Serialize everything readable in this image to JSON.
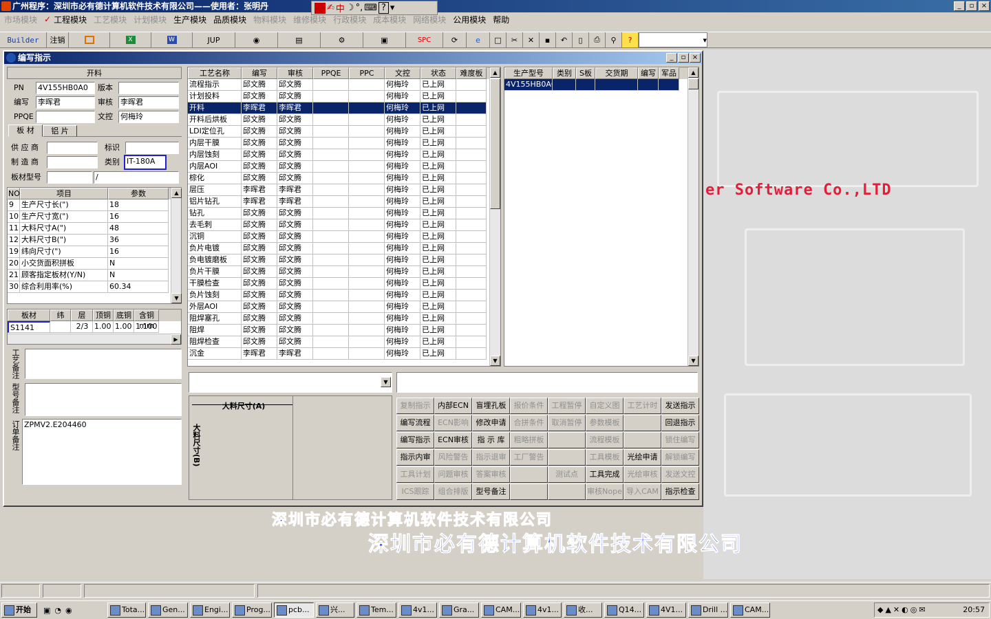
{
  "app": {
    "title": "广州程序：深圳市必有德计算机软件技术有限公司——使用者：张明丹"
  },
  "ime": {
    "zh": "中",
    "window_buttons": [
      "_",
      "▫",
      "×"
    ]
  },
  "menu": [
    {
      "label": "市场模块",
      "enabled": false
    },
    {
      "label": "工程模块",
      "enabled": true
    },
    {
      "label": "工艺模块",
      "enabled": false
    },
    {
      "label": "计划模块",
      "enabled": false
    },
    {
      "label": "生产模块",
      "enabled": true
    },
    {
      "label": "品质模块",
      "enabled": true
    },
    {
      "label": "物料模块",
      "enabled": false
    },
    {
      "label": "维修模块",
      "enabled": false
    },
    {
      "label": "行政模块",
      "enabled": false
    },
    {
      "label": "成本模块",
      "enabled": false
    },
    {
      "label": "网络模块",
      "enabled": false
    },
    {
      "label": "公用模块",
      "enabled": true
    },
    {
      "label": "帮助",
      "enabled": true
    }
  ],
  "toolbar": {
    "builder": "Builder",
    "cancel": "注销",
    "jup": "JUP",
    "spc": "SPC"
  },
  "background": {
    "software": "er Software Co.,LTD",
    "company_small": "深圳市必有德计算机软件技术有限公司",
    "company_large": "深圳市必有德计算机软件技术有限公司"
  },
  "dialog": {
    "title": "编写指示",
    "section": "开料",
    "pn_label": "PN",
    "pn": "4V155HB0A0",
    "version_label": "版本",
    "version": "",
    "writer_label": "编写",
    "writer": "李晖君",
    "reviewer_label": "审核",
    "reviewer": "李晖君",
    "ppqe_label": "PPQE",
    "ppqe": "",
    "doc_label": "文控",
    "doc": "何梅玲",
    "tabs": [
      "板 材",
      "铝 片"
    ],
    "supplier_label": "供 应 商",
    "supplier": "",
    "mark_label": "标识",
    "mark": "",
    "maker_label": "制 造 商",
    "maker": "",
    "type_label": "类别",
    "type": "IT-180A",
    "model_label": "板材型号",
    "model": "",
    "model2": "/",
    "param_headers": [
      "NO",
      "项目",
      "参数"
    ],
    "params": [
      {
        "no": "9",
        "item": "生产尺寸长(\")",
        "val": "18"
      },
      {
        "no": "10",
        "item": "生产尺寸宽(\")",
        "val": "16"
      },
      {
        "no": "11",
        "item": "大料尺寸A(\")",
        "val": "48"
      },
      {
        "no": "12",
        "item": "大料尺寸B(\")",
        "val": "36"
      },
      {
        "no": "19",
        "item": "纬向尺寸(\")",
        "val": "16"
      },
      {
        "no": "20",
        "item": "小交货面积拼板",
        "val": "N"
      },
      {
        "no": "21",
        "item": "顾客指定板材(Y/N)",
        "val": "N"
      },
      {
        "no": "30",
        "item": "综合利用率(%)",
        "val": "60.34"
      }
    ],
    "mat_headers": [
      "板材",
      "纬",
      "层",
      "顶铜",
      "底铜",
      "含铜mm"
    ],
    "mat_row": {
      "name": "S1141",
      "weft": "",
      "layer": "2/3",
      "top": "1.00",
      "bottom": "1.00",
      "cu": "1.100"
    },
    "remark_labels": [
      "工艺备注",
      "型号备注",
      "订单备注"
    ],
    "order_remark": "ZPMV2.E204460",
    "process_headers": [
      "工艺名称",
      "编写",
      "审核",
      "PPQE",
      "PPC",
      "文控",
      "状态",
      "难度板"
    ],
    "processes": [
      {
        "name": "流程指示",
        "w": "邱文腾",
        "r": "邱文腾",
        "d": "何梅玲",
        "s": "已上网"
      },
      {
        "name": "计划投料",
        "w": "邱文腾",
        "r": "邱文腾",
        "d": "何梅玲",
        "s": "已上网"
      },
      {
        "name": "开料",
        "w": "李晖君",
        "r": "李晖君",
        "d": "何梅玲",
        "s": "已上网",
        "sel": true
      },
      {
        "name": "开料后烘板",
        "w": "邱文腾",
        "r": "邱文腾",
        "d": "何梅玲",
        "s": "已上网"
      },
      {
        "name": "LDI定位孔",
        "w": "邱文腾",
        "r": "邱文腾",
        "d": "何梅玲",
        "s": "已上网"
      },
      {
        "name": "内层干膜",
        "w": "邱文腾",
        "r": "邱文腾",
        "d": "何梅玲",
        "s": "已上网"
      },
      {
        "name": "内层蚀刻",
        "w": "邱文腾",
        "r": "邱文腾",
        "d": "何梅玲",
        "s": "已上网"
      },
      {
        "name": "内层AOI",
        "w": "邱文腾",
        "r": "邱文腾",
        "d": "何梅玲",
        "s": "已上网"
      },
      {
        "name": "棕化",
        "w": "邱文腾",
        "r": "邱文腾",
        "d": "何梅玲",
        "s": "已上网"
      },
      {
        "name": "层压",
        "w": "李晖君",
        "r": "李晖君",
        "d": "何梅玲",
        "s": "已上网"
      },
      {
        "name": "铝片钻孔",
        "w": "李晖君",
        "r": "李晖君",
        "d": "何梅玲",
        "s": "已上网"
      },
      {
        "name": "钻孔",
        "w": "邱文腾",
        "r": "邱文腾",
        "d": "何梅玲",
        "s": "已上网"
      },
      {
        "name": "去毛刺",
        "w": "邱文腾",
        "r": "邱文腾",
        "d": "何梅玲",
        "s": "已上网"
      },
      {
        "name": "沉铜",
        "w": "邱文腾",
        "r": "邱文腾",
        "d": "何梅玲",
        "s": "已上网"
      },
      {
        "name": "负片电镀",
        "w": "邱文腾",
        "r": "邱文腾",
        "d": "何梅玲",
        "s": "已上网"
      },
      {
        "name": "负电镀磨板",
        "w": "邱文腾",
        "r": "邱文腾",
        "d": "何梅玲",
        "s": "已上网"
      },
      {
        "name": "负片干膜",
        "w": "邱文腾",
        "r": "邱文腾",
        "d": "何梅玲",
        "s": "已上网"
      },
      {
        "name": "干膜检查",
        "w": "邱文腾",
        "r": "邱文腾",
        "d": "何梅玲",
        "s": "已上网"
      },
      {
        "name": "负片蚀刻",
        "w": "邱文腾",
        "r": "邱文腾",
        "d": "何梅玲",
        "s": "已上网"
      },
      {
        "name": "外层AOI",
        "w": "邱文腾",
        "r": "邱文腾",
        "d": "何梅玲",
        "s": "已上网"
      },
      {
        "name": "阻焊塞孔",
        "w": "邱文腾",
        "r": "邱文腾",
        "d": "何梅玲",
        "s": "已上网"
      },
      {
        "name": "阻焊",
        "w": "邱文腾",
        "r": "邱文腾",
        "d": "何梅玲",
        "s": "已上网"
      },
      {
        "name": "阻焊检查",
        "w": "邱文腾",
        "r": "邱文腾",
        "d": "何梅玲",
        "s": "已上网"
      },
      {
        "name": "沉金",
        "w": "李晖君",
        "r": "李晖君",
        "d": "何梅玲",
        "s": "已上网"
      }
    ],
    "prod_headers": [
      "生产型号",
      "类别",
      "S板",
      "交货期",
      "编写",
      "军品"
    ],
    "prod_row": "4V155HB0A0",
    "dim_a": "大料尺寸(A)",
    "dim_b": "大料尺寸(B)",
    "buttons": [
      [
        {
          "l": "复制指示",
          "e": false
        },
        {
          "l": "内部ECN",
          "e": true
        },
        {
          "l": "盲埋孔板",
          "e": true
        },
        {
          "l": "报价条件",
          "e": false
        },
        {
          "l": "工程暂停",
          "e": false
        },
        {
          "l": "自定义图",
          "e": false
        },
        {
          "l": "工艺计时",
          "e": false
        },
        {
          "l": "发送指示",
          "e": true
        }
      ],
      [
        {
          "l": "编写流程",
          "e": true
        },
        {
          "l": "ECN影响",
          "e": false
        },
        {
          "l": "修改申请",
          "e": true
        },
        {
          "l": "合拼条件",
          "e": false
        },
        {
          "l": "取消暂停",
          "e": false
        },
        {
          "l": "参数模板",
          "e": false
        },
        {
          "l": "",
          "e": false
        },
        {
          "l": "回退指示",
          "e": true
        }
      ],
      [
        {
          "l": "编写指示",
          "e": true
        },
        {
          "l": "ECN审核",
          "e": true
        },
        {
          "l": "指 示 库",
          "e": true
        },
        {
          "l": "粗略拼板",
          "e": false
        },
        {
          "l": "",
          "e": false
        },
        {
          "l": "流程模板",
          "e": false
        },
        {
          "l": "",
          "e": false
        },
        {
          "l": "锁住编写",
          "e": false
        }
      ],
      [
        {
          "l": "指示内审",
          "e": true
        },
        {
          "l": "风险警告",
          "e": false
        },
        {
          "l": "指示退审",
          "e": false
        },
        {
          "l": "工厂警告",
          "e": false
        },
        {
          "l": "",
          "e": false
        },
        {
          "l": "工具模板",
          "e": false
        },
        {
          "l": "光绘申请",
          "e": true
        },
        {
          "l": "解锁编写",
          "e": false
        }
      ],
      [
        {
          "l": "工具计划",
          "e": false
        },
        {
          "l": "问题审核",
          "e": false
        },
        {
          "l": "答案审核",
          "e": false
        },
        {
          "l": "",
          "e": false
        },
        {
          "l": "测试点",
          "e": false
        },
        {
          "l": "工具完成",
          "e": true
        },
        {
          "l": "光绘审核",
          "e": false
        },
        {
          "l": "发送文控",
          "e": false
        }
      ],
      [
        {
          "l": "ICS跟踪",
          "e": false
        },
        {
          "l": "组合排版",
          "e": false
        },
        {
          "l": "型号备注",
          "e": true
        },
        {
          "l": "",
          "e": false
        },
        {
          "l": "",
          "e": false
        },
        {
          "l": "审核Nope",
          "e": false
        },
        {
          "l": "导入CAM",
          "e": false
        },
        {
          "l": "指示检查",
          "e": true
        }
      ]
    ]
  },
  "taskbar": {
    "start": "开始",
    "items": [
      "Tota...",
      "Gen...",
      "Engi...",
      "Prog...",
      "pcb...",
      "兴...",
      "Tem...",
      "4v1...",
      "Gra...",
      "CAM...",
      "4v1...",
      "收...",
      "Q14...",
      "4V1...",
      "Drill ...",
      "CAM..."
    ],
    "active_index": 4,
    "clock": "20:57"
  }
}
